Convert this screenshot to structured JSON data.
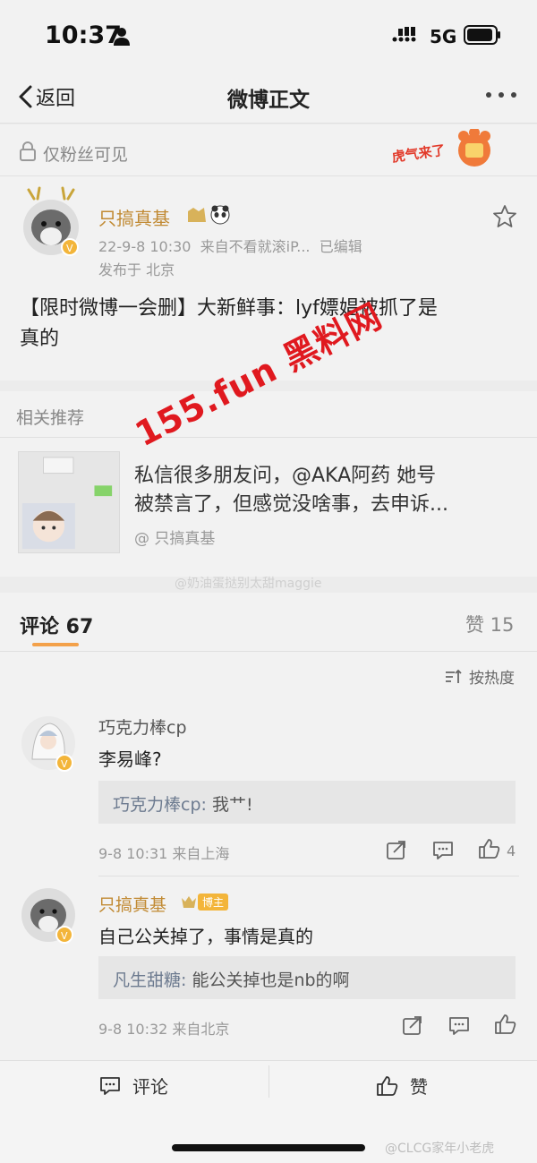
{
  "status_bar": {
    "time": "10:37",
    "network": "5G"
  },
  "nav": {
    "back_label": "返回",
    "title": "微博正文"
  },
  "visibility": {
    "label": "仅粉丝可见",
    "sticker_text": "虎气来了"
  },
  "post": {
    "author": "只搞真基",
    "timestamp": "22-9-8 10:30",
    "source": "来自不看就滚iP...",
    "edited": "已编辑",
    "location": "发布于 北京",
    "body_line1": "【限时微博一会删】大新鲜事：lyf嫖娼被抓了是",
    "body_line2": "真的"
  },
  "related": {
    "title": "相关推荐",
    "text_line1": "私信很多朋友问，@AKA阿药 她号",
    "text_line2": "被禁言了，但感觉没啥事，去申诉...",
    "author": "@ 只搞真基"
  },
  "watermarks": {
    "middle": "@奶油蛋挞别太甜maggie",
    "bottom": "@CLCG家年小老虎",
    "overlay": "155.fun 黑料网"
  },
  "comments_header": {
    "comments_label": "评论 67",
    "likes_label": "赞 15",
    "sort_label": "按热度"
  },
  "comments": [
    {
      "author": "巧克力棒cp",
      "text": "李易峰?",
      "quote_author": "巧克力棒cp:",
      "quote_text": "我艹!",
      "meta": "9-8 10:31 来自上海",
      "like_count": "4"
    },
    {
      "author": "只搞真基",
      "badge": "博主",
      "text": "自己公关掉了，事情是真的",
      "quote_author": "凡生甜糖:",
      "quote_text": "能公关掉也是nb的啊",
      "meta": "9-8 10:32 来自北京",
      "like_count": ""
    }
  ],
  "bottom_bar": {
    "comment_label": "评论",
    "like_label": "赞"
  },
  "colors": {
    "accent": "#f3a14a",
    "username": "#c18a33",
    "overlay": "#e0191f"
  }
}
